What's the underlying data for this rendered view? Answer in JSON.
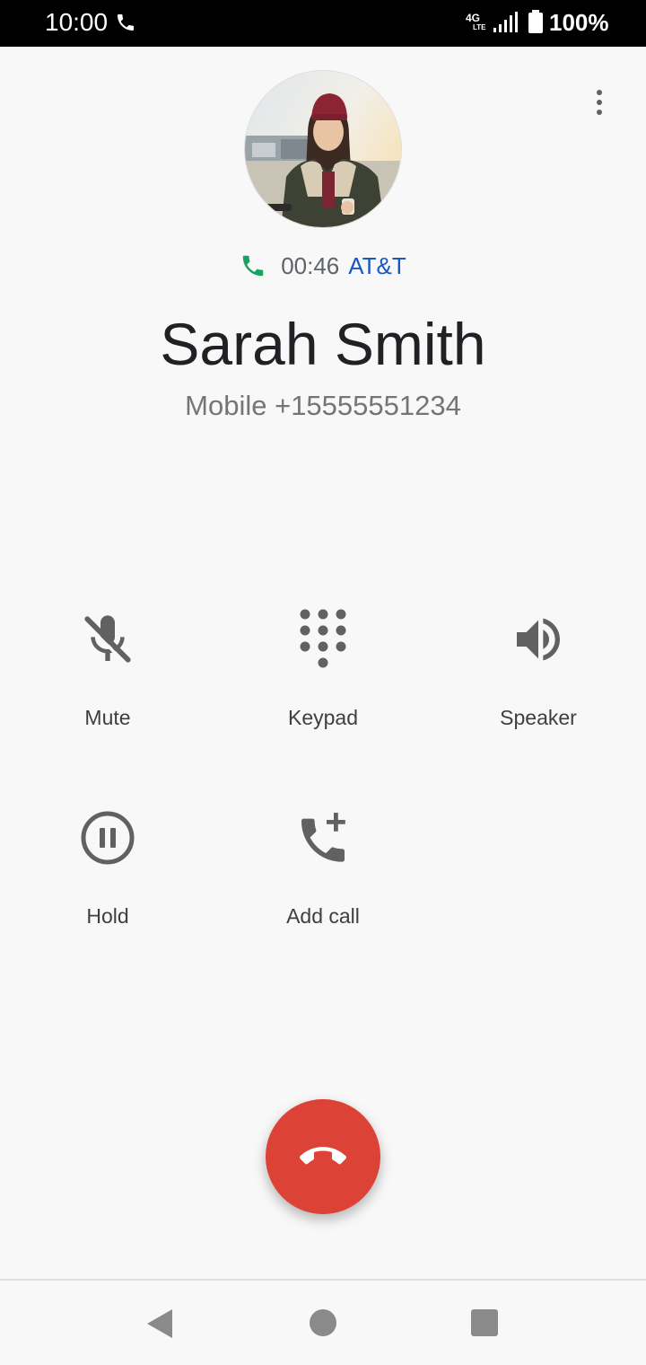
{
  "status_bar": {
    "time": "10:00",
    "network_type": "4G",
    "network_sub": "LTE",
    "battery": "100%"
  },
  "call": {
    "timer": "00:46",
    "carrier": "AT&T",
    "caller_name": "Sarah Smith",
    "caller_number": "Mobile +15555551234"
  },
  "controls": {
    "mute": "Mute",
    "keypad": "Keypad",
    "speaker": "Speaker",
    "hold": "Hold",
    "add_call": "Add call"
  },
  "colors": {
    "end_call": "#dc4236",
    "carrier": "#1a56c4",
    "call_active_icon": "#1aa260"
  },
  "icons": {
    "status_call": "phone-in-talk-icon",
    "overflow": "more-vert-icon",
    "mute": "mic-off-icon",
    "keypad": "dialpad-icon",
    "speaker": "volume-up-icon",
    "hold": "pause-circle-icon",
    "add_call": "add-call-icon",
    "end_call": "call-end-icon"
  }
}
